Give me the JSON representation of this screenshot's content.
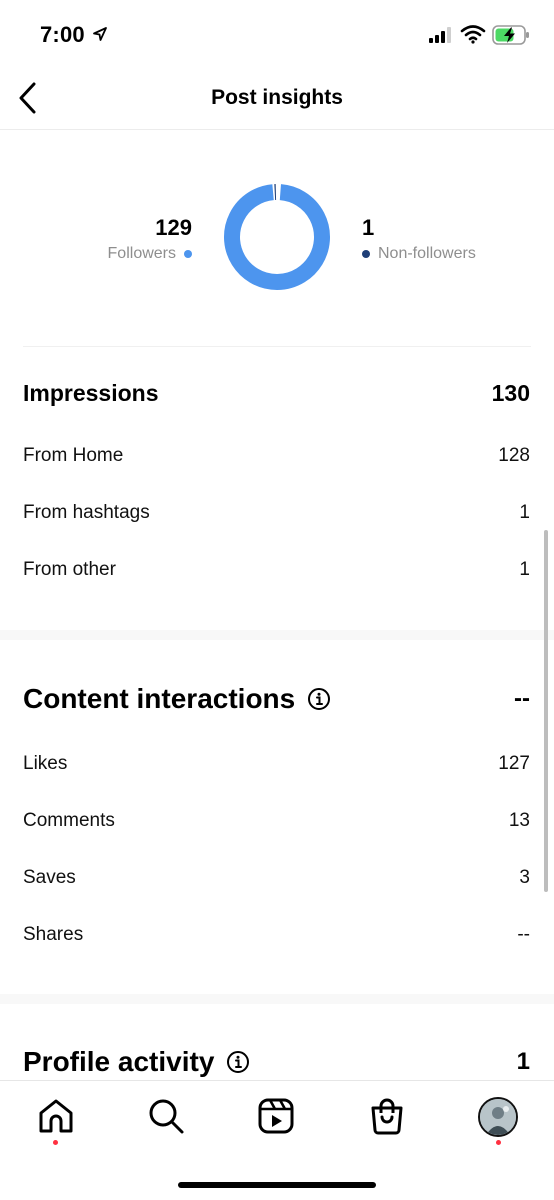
{
  "status_bar": {
    "time": "7:00"
  },
  "header": {
    "title": "Post insights"
  },
  "audience": {
    "followers": {
      "count": "129",
      "label": "Followers",
      "color": "#4d95ee"
    },
    "non_followers": {
      "count": "1",
      "label": "Non-followers",
      "color": "#1f3f77"
    },
    "followers_fraction": 0.992
  },
  "impressions": {
    "title": "Impressions",
    "total": "130",
    "rows": [
      {
        "label": "From Home",
        "value": "128"
      },
      {
        "label": "From hashtags",
        "value": "1"
      },
      {
        "label": "From other",
        "value": "1"
      }
    ]
  },
  "content_interactions": {
    "title": "Content interactions",
    "total": "--",
    "rows": [
      {
        "label": "Likes",
        "value": "127"
      },
      {
        "label": "Comments",
        "value": "13"
      },
      {
        "label": "Saves",
        "value": "3"
      },
      {
        "label": "Shares",
        "value": "--"
      }
    ]
  },
  "profile_activity": {
    "title": "Profile activity",
    "total": "1"
  },
  "bottom_nav": {
    "items": [
      "home-icon",
      "search-icon",
      "reels-icon",
      "shop-icon",
      "profile-avatar"
    ]
  }
}
